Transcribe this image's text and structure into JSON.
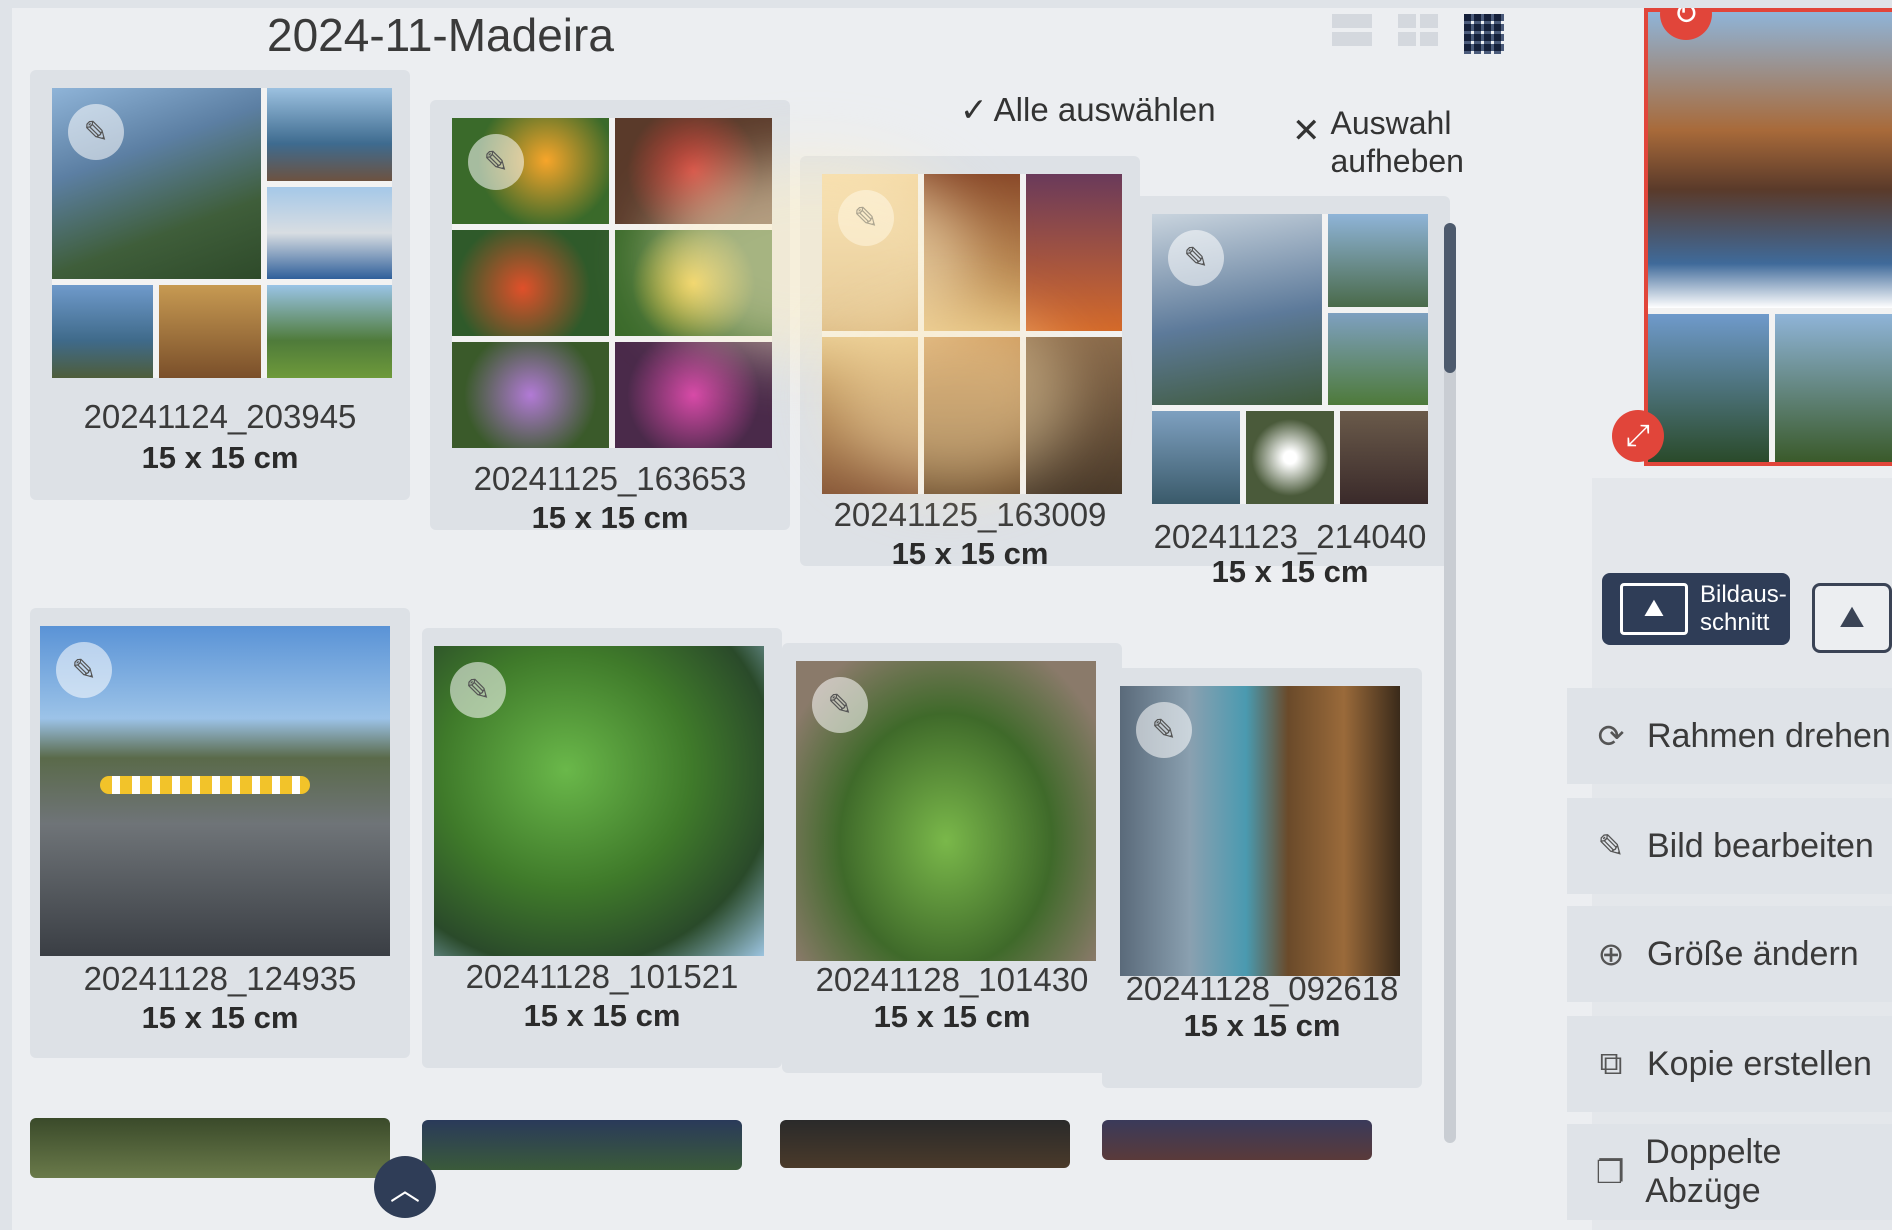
{
  "gallery": {
    "title": "2024-11-Madeira"
  },
  "toolbar": {
    "select_all": "Alle auswählen",
    "deselect": "Auswahl aufheben"
  },
  "cards": [
    {
      "name": "20241124_203945",
      "size": "15 x 15 cm"
    },
    {
      "name": "20241125_163653",
      "size": "15 x 15 cm"
    },
    {
      "name": "20241125_163009",
      "size": "15 x 15 cm"
    },
    {
      "name": "20241123_214040",
      "size": "15 x 15 cm"
    },
    {
      "name": "20241128_124935",
      "size": "15 x 15 cm"
    },
    {
      "name": "20241128_101521",
      "size": "15 x 15 cm"
    },
    {
      "name": "20241128_101430",
      "size": "15 x 15 cm"
    },
    {
      "name": "20241128_092618",
      "size": "15 x 15 cm"
    }
  ],
  "side_panel": {
    "crop_label": "Bildaus-schnitt",
    "actions": [
      {
        "label": "Rahmen drehen",
        "icon": "rotate-icon"
      },
      {
        "label": "Bild bearbeiten",
        "icon": "edit-icon"
      },
      {
        "label": "Größe ändern",
        "icon": "plus-circle-icon"
      },
      {
        "label": "Kopie erstellen",
        "icon": "copy-icon"
      },
      {
        "label": "Doppelte Abzüge",
        "icon": "duplicate-icon"
      }
    ]
  },
  "colors": {
    "accent": "#e1453a",
    "dark_button": "#2f3d57",
    "background": "#eceef1"
  }
}
